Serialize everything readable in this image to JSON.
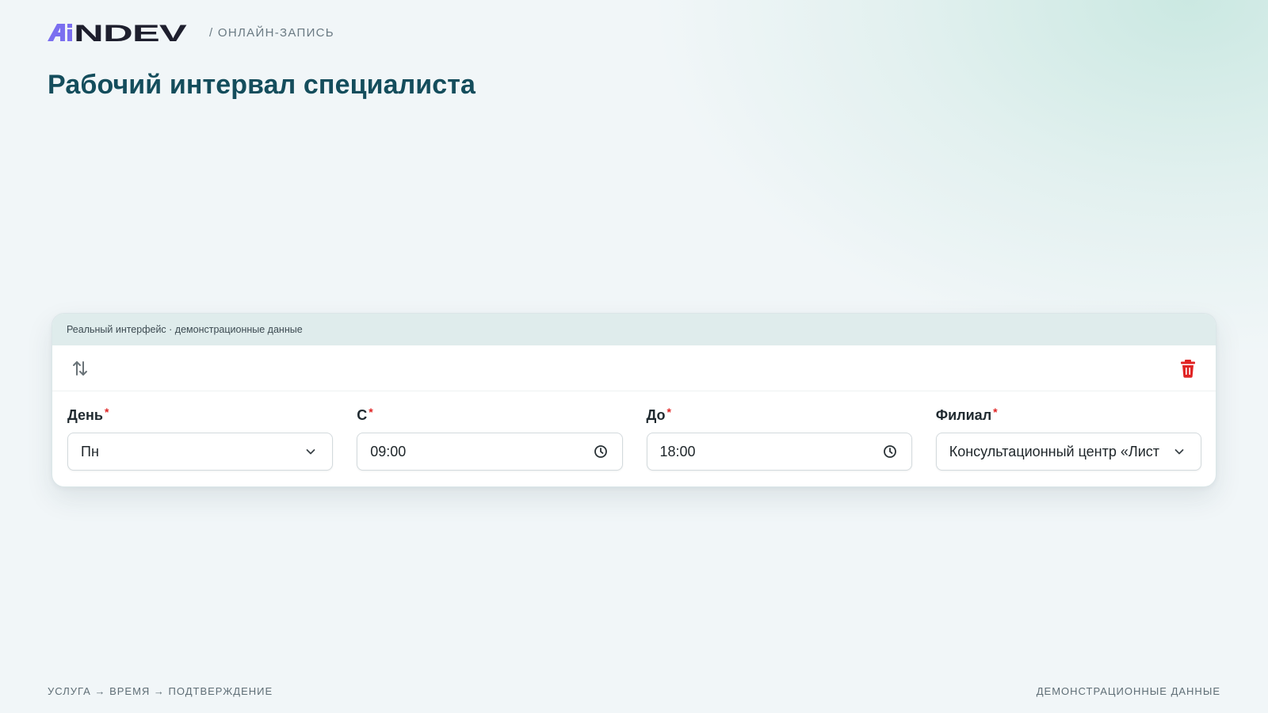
{
  "brand": {
    "logo_text": "AiNDEV",
    "colors": {
      "accent": "#7b6ff0",
      "dark": "#1e1f2e"
    }
  },
  "header": {
    "breadcrumb": "/ ОНЛАЙН-ЗАПИСЬ",
    "title": "Рабочий интервал специалиста"
  },
  "card": {
    "banner": "Реальный интерфейс · демонстрационные данные",
    "icons": {
      "sort": "swap-vertical-icon",
      "delete": "trash-icon"
    },
    "fields": {
      "day": {
        "label": "День",
        "required": "*",
        "value": "Пн"
      },
      "from": {
        "label": "С",
        "required": "*",
        "value": "09:00"
      },
      "to": {
        "label": "До",
        "required": "*",
        "value": "18:00"
      },
      "branch": {
        "label": "Филиал",
        "required": "*",
        "value": "Консультационный центр «Лист"
      }
    },
    "colors": {
      "delete": "#e02424",
      "header_bg": "#dfecec"
    }
  },
  "footer": {
    "steps": "УСЛУГА → ВРЕМЯ → ПОДТВЕРЖДЕНИЕ",
    "note": "ДЕМОНСТРАЦИОННЫЕ ДАННЫЕ"
  }
}
